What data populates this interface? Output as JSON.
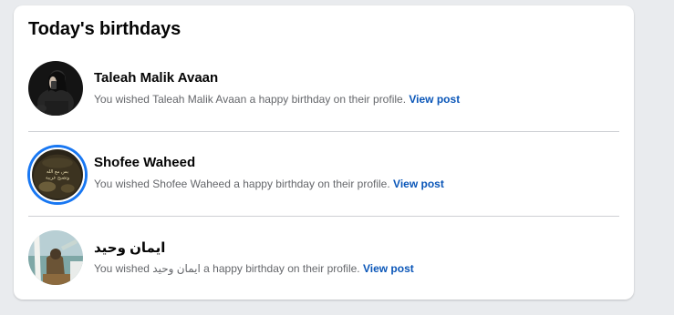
{
  "card": {
    "title": "Today's birthdays"
  },
  "birthdays": [
    {
      "name": "Taleah Malik Avaan",
      "message_prefix": "You wished",
      "message_name": "Taleah Malik Avaan",
      "message_suffix": "a happy birthday on their profile.",
      "link": "View post",
      "has_story": false
    },
    {
      "name": "Shofee Waheed",
      "message_prefix": "You wished",
      "message_name": "Shofee Waheed",
      "message_suffix": "a happy birthday on their profile.",
      "link": "View post",
      "has_story": true,
      "avatar_text": "بس مع الله وتصبح غريبة"
    },
    {
      "name": "ايمان وحيد",
      "message_prefix": "You wished",
      "message_name": "ايمان وحيد",
      "message_suffix": "a happy birthday on their profile.",
      "link": "View post",
      "has_story": false
    }
  ],
  "colors": {
    "link": "#0a56b8",
    "story_ring": "#1877f2",
    "text_primary": "#050505",
    "text_secondary": "#65676b",
    "divider": "#ced0d4",
    "page_background": "#e9ebee",
    "card_background": "#ffffff"
  }
}
